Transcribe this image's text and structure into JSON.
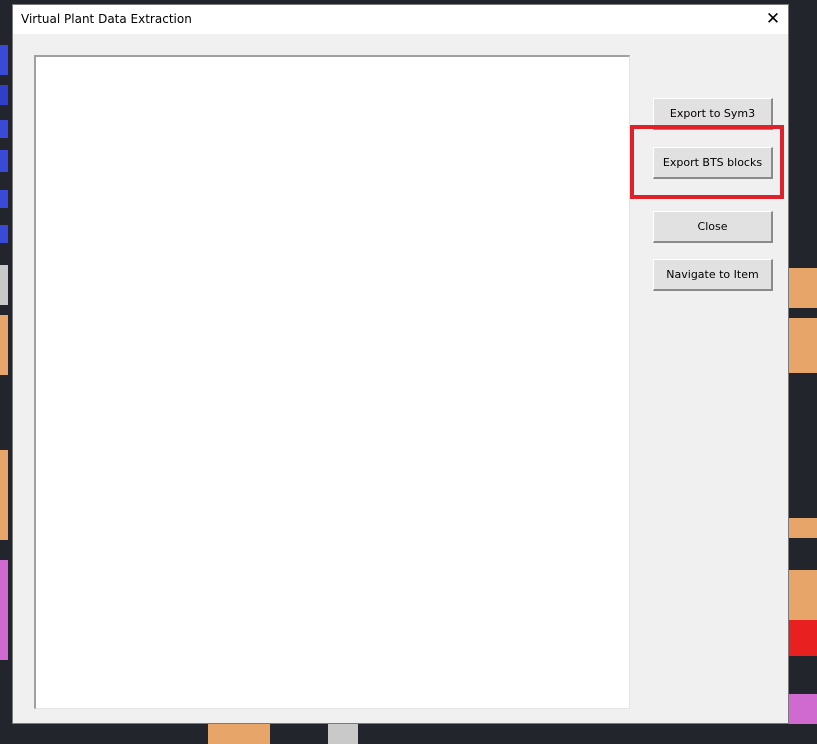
{
  "dialog": {
    "title": "Virtual Plant Data Extraction",
    "close_glyph": "✕"
  },
  "buttons": {
    "export_sym3": "Export to Sym3",
    "export_bts": "Export BTS blocks",
    "close": "Close",
    "navigate": "Navigate to Item"
  },
  "colors": {
    "highlight": "#e0202a",
    "cad_background": "#22252b"
  }
}
